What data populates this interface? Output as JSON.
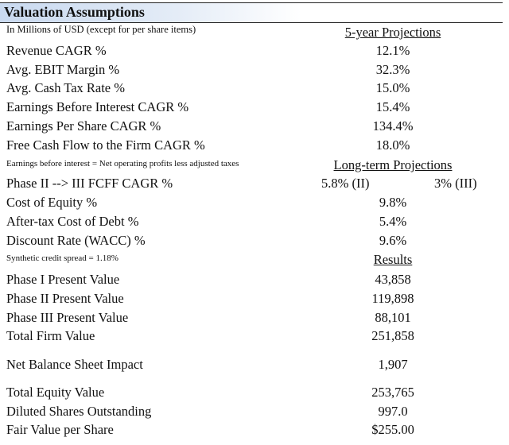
{
  "title": "Valuation Assumptions",
  "subtitle": "In Millions of USD (except for per share items)",
  "sections": {
    "five_year": "5-year Projections",
    "long_term": "Long-term Projections",
    "results": "Results"
  },
  "five_year_rows": [
    {
      "label": "Revenue CAGR %",
      "value": "12.1%"
    },
    {
      "label": "Avg. EBIT Margin %",
      "value": "32.3%"
    },
    {
      "label": "Avg. Cash Tax Rate %",
      "value": "15.0%"
    },
    {
      "label": "Earnings Before Interest CAGR %",
      "value": "15.4%"
    },
    {
      "label": "Earnings Per Share CAGR %",
      "value": "134.4%"
    },
    {
      "label": "Free Cash Flow to the Firm CAGR %",
      "value": "18.0%"
    }
  ],
  "note_ebi": "Earnings before interest = Net operating profits less adjusted taxes",
  "long_term_rows": {
    "phase": {
      "label": "Phase II --> III FCFF CAGR %",
      "value_ii": "5.8% (II)",
      "value_iii": "3% (III)"
    },
    "rows": [
      {
        "label": "Cost of Equity %",
        "value": "9.8%"
      },
      {
        "label": "After-tax Cost of Debt %",
        "value": "5.4%"
      },
      {
        "label": "Discount Rate (WACC) %",
        "value": "9.6%"
      }
    ]
  },
  "note_spread": "Synthetic credit spread = 1.18%",
  "results_rows": [
    {
      "label": "Phase I Present Value",
      "value": "43,858"
    },
    {
      "label": "Phase II Present Value",
      "value": "119,898"
    },
    {
      "label": "Phase III Present Value",
      "value": "88,101"
    },
    {
      "label": "Total Firm Value",
      "value": "251,858"
    }
  ],
  "balance": {
    "label": "Net Balance Sheet Impact",
    "value": "1,907"
  },
  "equity_rows": [
    {
      "label": "Total Equity Value",
      "value": "253,765"
    },
    {
      "label": "Diluted Shares Outstanding",
      "value": "997.0"
    },
    {
      "label": "Fair Value per Share",
      "value": "$255.00"
    }
  ]
}
